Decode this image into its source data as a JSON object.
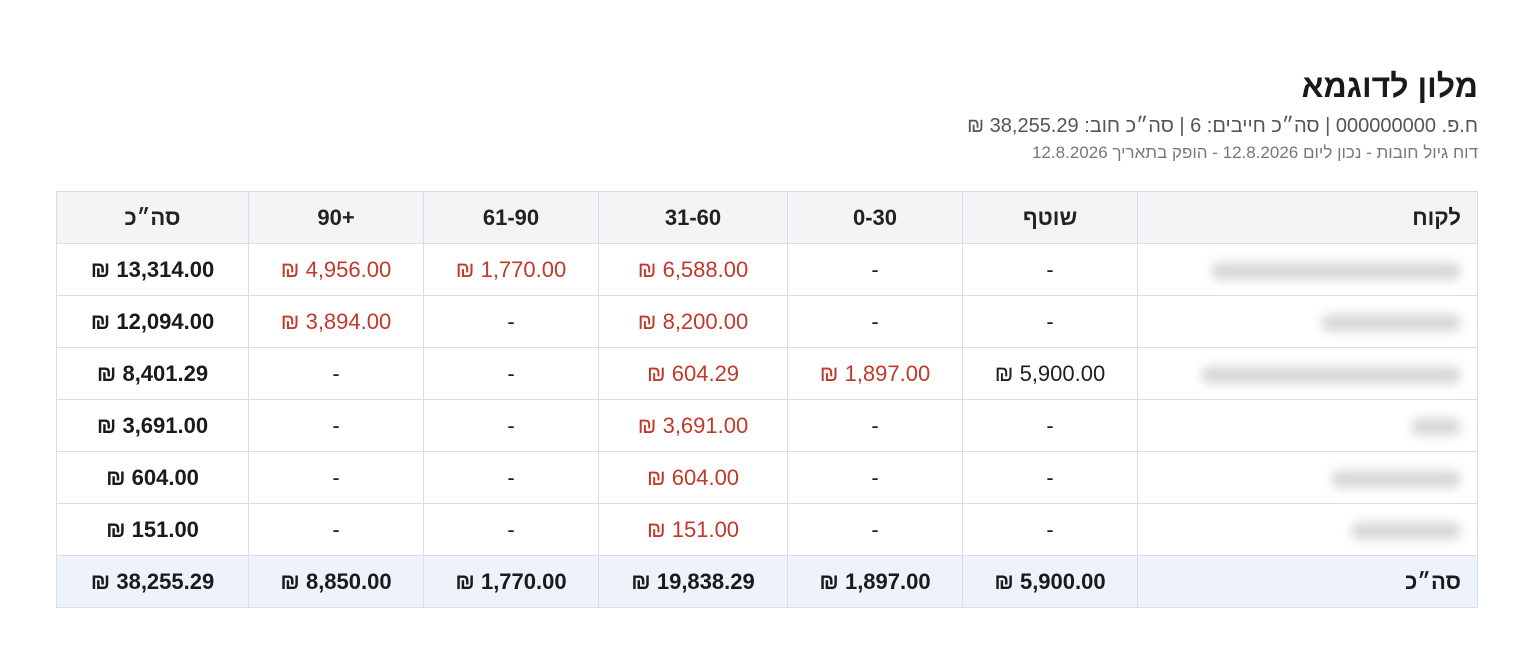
{
  "report": {
    "title": "מלון לדוגמא",
    "meta_line": "ח.פ. 000000000 | סה״כ חייבים: 6 | סה״כ חוב: 38,255.29 ₪",
    "subtitle": "דוח גיול חובות - נכון ליום 12.8.2026 - הופק בתאריך 12.8.2026"
  },
  "table": {
    "headers": {
      "customer": "לקוח",
      "current": "שוטף",
      "b0_30": "0-30",
      "b31_60": "31-60",
      "b61_90": "61-90",
      "b90p": "+90",
      "total": "סה״כ"
    },
    "rows": [
      {
        "current": "-",
        "b0_30": "-",
        "b31_60": "6,588.00 ₪",
        "b61_90": "1,770.00 ₪",
        "b90p": "4,956.00 ₪",
        "total": "13,314.00 ₪"
      },
      {
        "current": "-",
        "b0_30": "-",
        "b31_60": "8,200.00 ₪",
        "b61_90": "-",
        "b90p": "3,894.00 ₪",
        "total": "12,094.00 ₪"
      },
      {
        "current": "5,900.00 ₪",
        "b0_30": "1,897.00 ₪",
        "b31_60": "604.29 ₪",
        "b61_90": "-",
        "b90p": "-",
        "total": "8,401.29 ₪"
      },
      {
        "current": "-",
        "b0_30": "-",
        "b31_60": "3,691.00 ₪",
        "b61_90": "-",
        "b90p": "-",
        "total": "3,691.00 ₪"
      },
      {
        "current": "-",
        "b0_30": "-",
        "b31_60": "604.00 ₪",
        "b61_90": "-",
        "b90p": "-",
        "total": "604.00 ₪"
      },
      {
        "current": "-",
        "b0_30": "-",
        "b31_60": "151.00 ₪",
        "b61_90": "-",
        "b90p": "-",
        "total": "151.00 ₪"
      }
    ],
    "footer": {
      "label": "סה״כ",
      "current": "5,900.00 ₪",
      "b0_30": "1,897.00 ₪",
      "b31_60": "19,838.29 ₪",
      "b61_90": "1,770.00 ₪",
      "b90p": "8,850.00 ₪",
      "total": "38,255.29 ₪"
    }
  },
  "colors": {
    "overdue_text": "#c0392b",
    "header_bg": "#f3f4f6",
    "footer_bg": "#eef2fb",
    "border": "#dadde1"
  }
}
